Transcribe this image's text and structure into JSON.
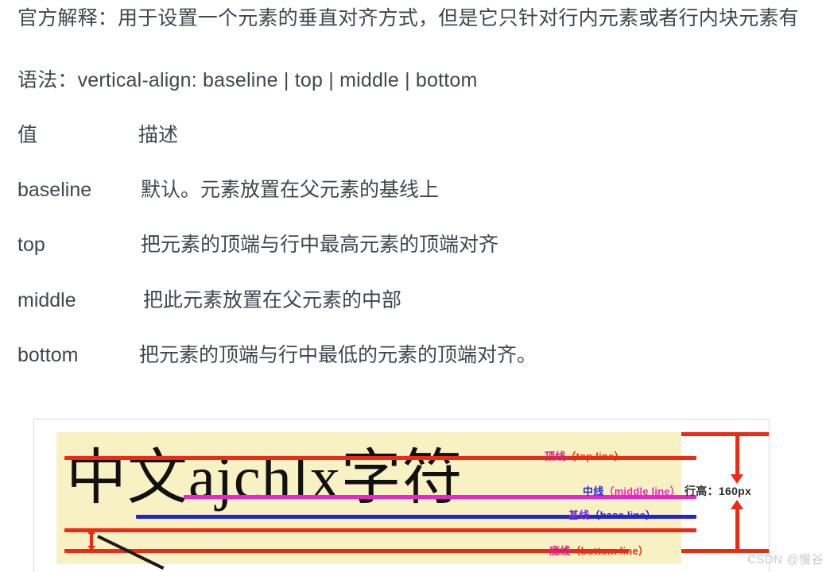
{
  "article": {
    "official": "官方解释：用于设置一个元素的垂直对齐方式，但是它只针对行内元素或者行内块元素有",
    "syntax": "语法：vertical-align: baseline | top | middle | bottom"
  },
  "table": {
    "header": {
      "term": "值",
      "desc": "描述"
    },
    "rows": [
      {
        "term": "baseline",
        "desc": "默认。元素放置在父元素的基线上"
      },
      {
        "term": "top",
        "desc": "把元素的顶端与行中最高元素的顶端对齐"
      },
      {
        "term": "middle",
        "desc": "把此元素放置在父元素的中部"
      },
      {
        "term": "bottom",
        "desc": "把元素的顶端与行中最低的元素的顶端对齐。"
      }
    ]
  },
  "figure": {
    "sample_text": "中文ajchlx字符",
    "legend": [
      {
        "cn": "顶线",
        "en": "（top line）",
        "color": "#ef2a12"
      },
      {
        "cn": "中线",
        "en": "（middle line）",
        "color": "#ee24cb"
      },
      {
        "cn": "基线",
        "en": "（base line）",
        "color": "#2323d6"
      },
      {
        "cn": "底线",
        "en": "（bottom line）",
        "color": "#ef2a12"
      }
    ],
    "line_height_label": "行高：160px",
    "colors": {
      "top_line": "#ef2a12",
      "middle_line": "#ee24cb",
      "base_line": "#2323d6",
      "bottom_line": "#ef2a12",
      "highlight": "#f8f1c4"
    }
  },
  "watermark": "CSDN @慢谷"
}
